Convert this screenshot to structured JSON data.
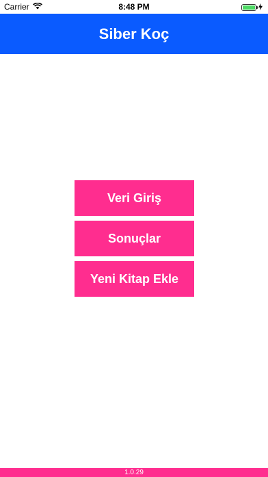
{
  "status_bar": {
    "carrier": "Carrier",
    "time": "8:48 PM",
    "icons": [
      "wifi-icon",
      "battery-icon",
      "charging-icon"
    ],
    "battery_level": 1.0
  },
  "nav": {
    "title": "Siber Koç",
    "background_color": "#0a5bff"
  },
  "menu": {
    "button_color": "#ff2d8f",
    "buttons": [
      {
        "label": "Veri Giriş"
      },
      {
        "label": "Sonuçlar"
      },
      {
        "label": "Yeni Kitap Ekle"
      }
    ]
  },
  "footer": {
    "version": "1.0.29"
  }
}
